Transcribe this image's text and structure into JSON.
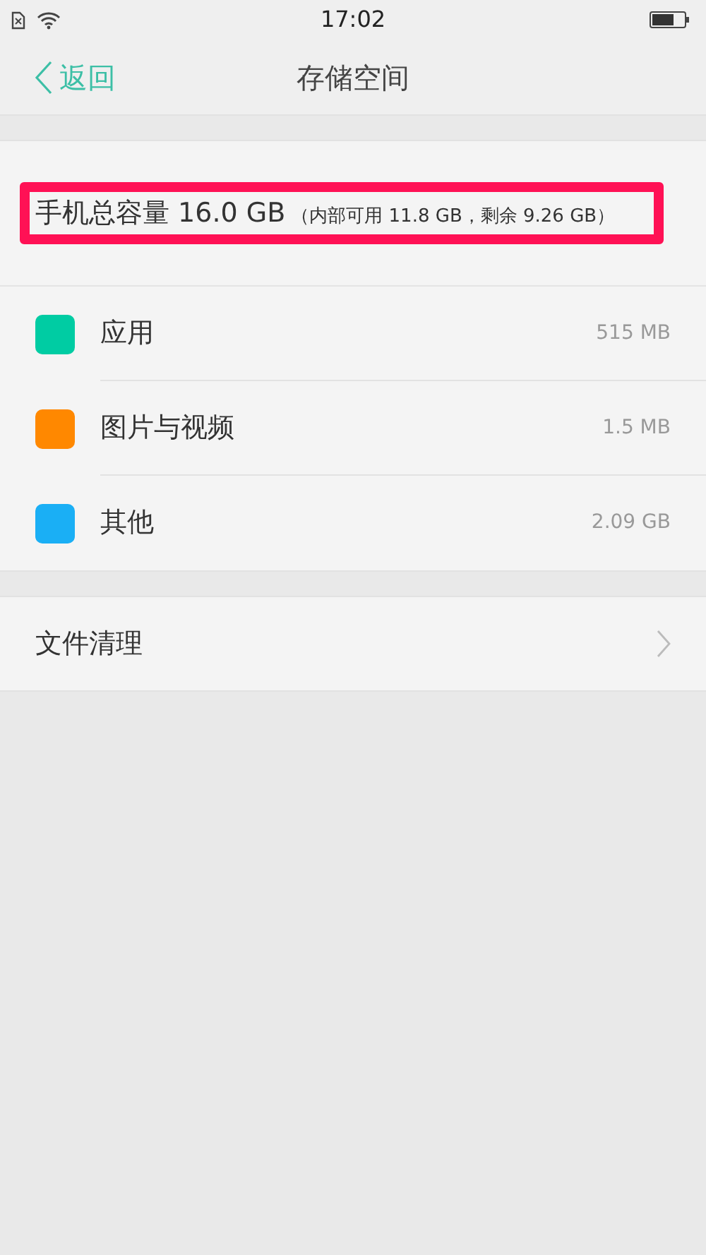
{
  "status_bar": {
    "time": "17:02"
  },
  "nav": {
    "back": "返回",
    "title": "存储空间"
  },
  "capacity": {
    "total": "手机总容量 16.0 GB",
    "detail": "（内部可用 11.8 GB，剩余 9.26 GB）",
    "highlighted": true
  },
  "categories": [
    {
      "label": "应用",
      "size": "515 MB",
      "color": "#00cca3"
    },
    {
      "label": "图片与视频",
      "size": "1.5 MB",
      "color": "#ff8800"
    },
    {
      "label": "其他",
      "size": "2.09 GB",
      "color": "#1aaff5"
    }
  ],
  "actions": [
    {
      "label": "文件清理"
    }
  ]
}
